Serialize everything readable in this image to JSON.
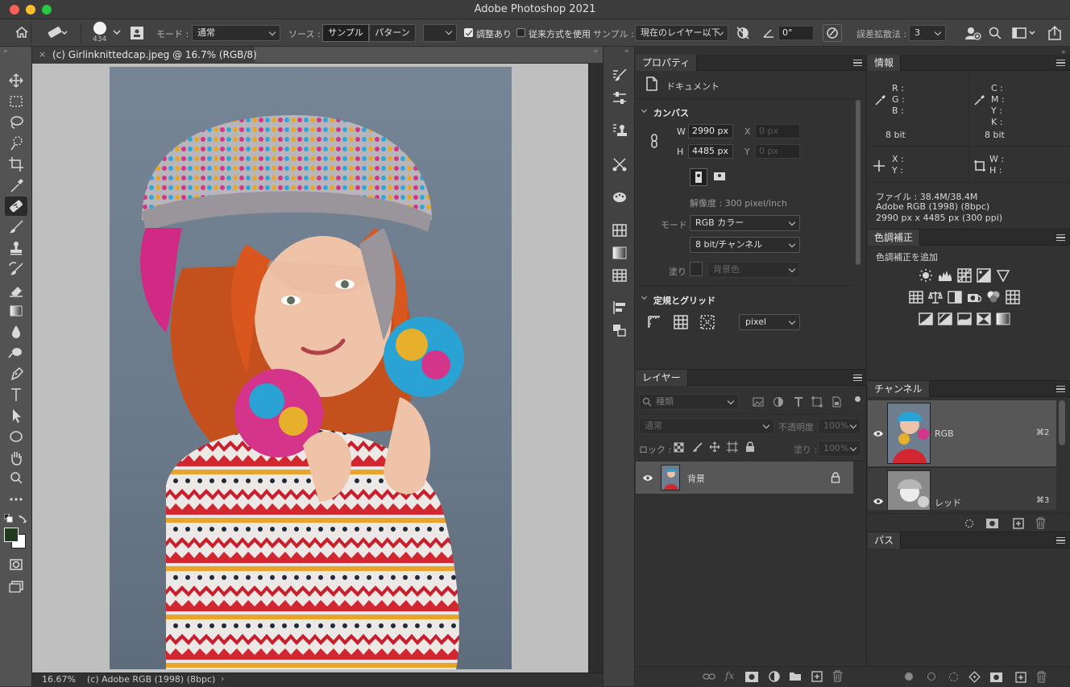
{
  "app": {
    "title": "Adobe Photoshop 2021",
    "colors": {
      "close": "#ff5f57",
      "minimize": "#febc2e",
      "zoom": "#28c840"
    }
  },
  "options": {
    "brush_size": "434",
    "mode_label": "モード :",
    "mode_value": "通常",
    "source_label": "ソース :",
    "source_sample": "サンプル",
    "source_pattern": "パターン",
    "aligned_label": "調整あり",
    "aligned_checked": true,
    "legacy_label": "従来方式を使用",
    "legacy_checked": false,
    "sample_label": "サンプル :",
    "sample_value": "現在のレイヤー以下",
    "angle_value": "0°",
    "diffusion_label": "誤差拡散法 :",
    "diffusion_value": "3"
  },
  "document": {
    "tab_title": "(c) Girlinknittedcap.jpeg @ 16.7% (RGB/8)",
    "zoom": "16.67%",
    "status": "(c) Adobe RGB (1998) (8bpc)",
    "background_color": "#6f7e8e"
  },
  "properties": {
    "tab": "プロパティ",
    "doc_label": "ドキュメント",
    "canvas_section": "カンバス",
    "w_label": "W",
    "w_value": "2990 px",
    "h_label": "H",
    "h_value": "4485 px",
    "x_label": "X",
    "x_value": "0 px",
    "y_label": "Y",
    "y_value": "0 px",
    "resolution": "解像度 : 300 pixel/inch",
    "mode_label": "モード",
    "mode_value": "RGB カラー",
    "depth_value": "8 bit/チャンネル",
    "fill_label": "塗り",
    "fill_value": "背景色",
    "guides_section": "定規とグリッド",
    "unit_value": "pixel"
  },
  "info": {
    "tab": "情報",
    "r": "R :",
    "g": "G :",
    "b": "B :",
    "bit_left": "8 bit",
    "c": "C :",
    "m": "M :",
    "y": "Y :",
    "k": "K :",
    "bit_right": "8 bit",
    "x": "X :",
    "yy": "Y :",
    "w": "W :",
    "h": "H :",
    "file": "ファイル : 38.4M/38.4M",
    "profile": "Adobe RGB (1998) (8bpc)",
    "dims": "2990 px x 4485 px (300 ppi)"
  },
  "adjustments": {
    "tab": "色調補正",
    "hint": "色調補正を追加"
  },
  "layers": {
    "tab": "レイヤー",
    "filter_placeholder": "種類",
    "blend": "通常",
    "opacity_label": "不透明度 :",
    "opacity_value": "100%",
    "lock_label": "ロック :",
    "fill_label": "塗り :",
    "fill_value": "100%",
    "items": [
      {
        "name": "背景",
        "locked": true
      }
    ]
  },
  "channels": {
    "tab": "チャンネル",
    "items": [
      {
        "name": "RGB",
        "shortcut": "⌘2"
      },
      {
        "name": "レッド",
        "shortcut": "⌘3"
      }
    ]
  },
  "paths": {
    "tab": "パス"
  }
}
